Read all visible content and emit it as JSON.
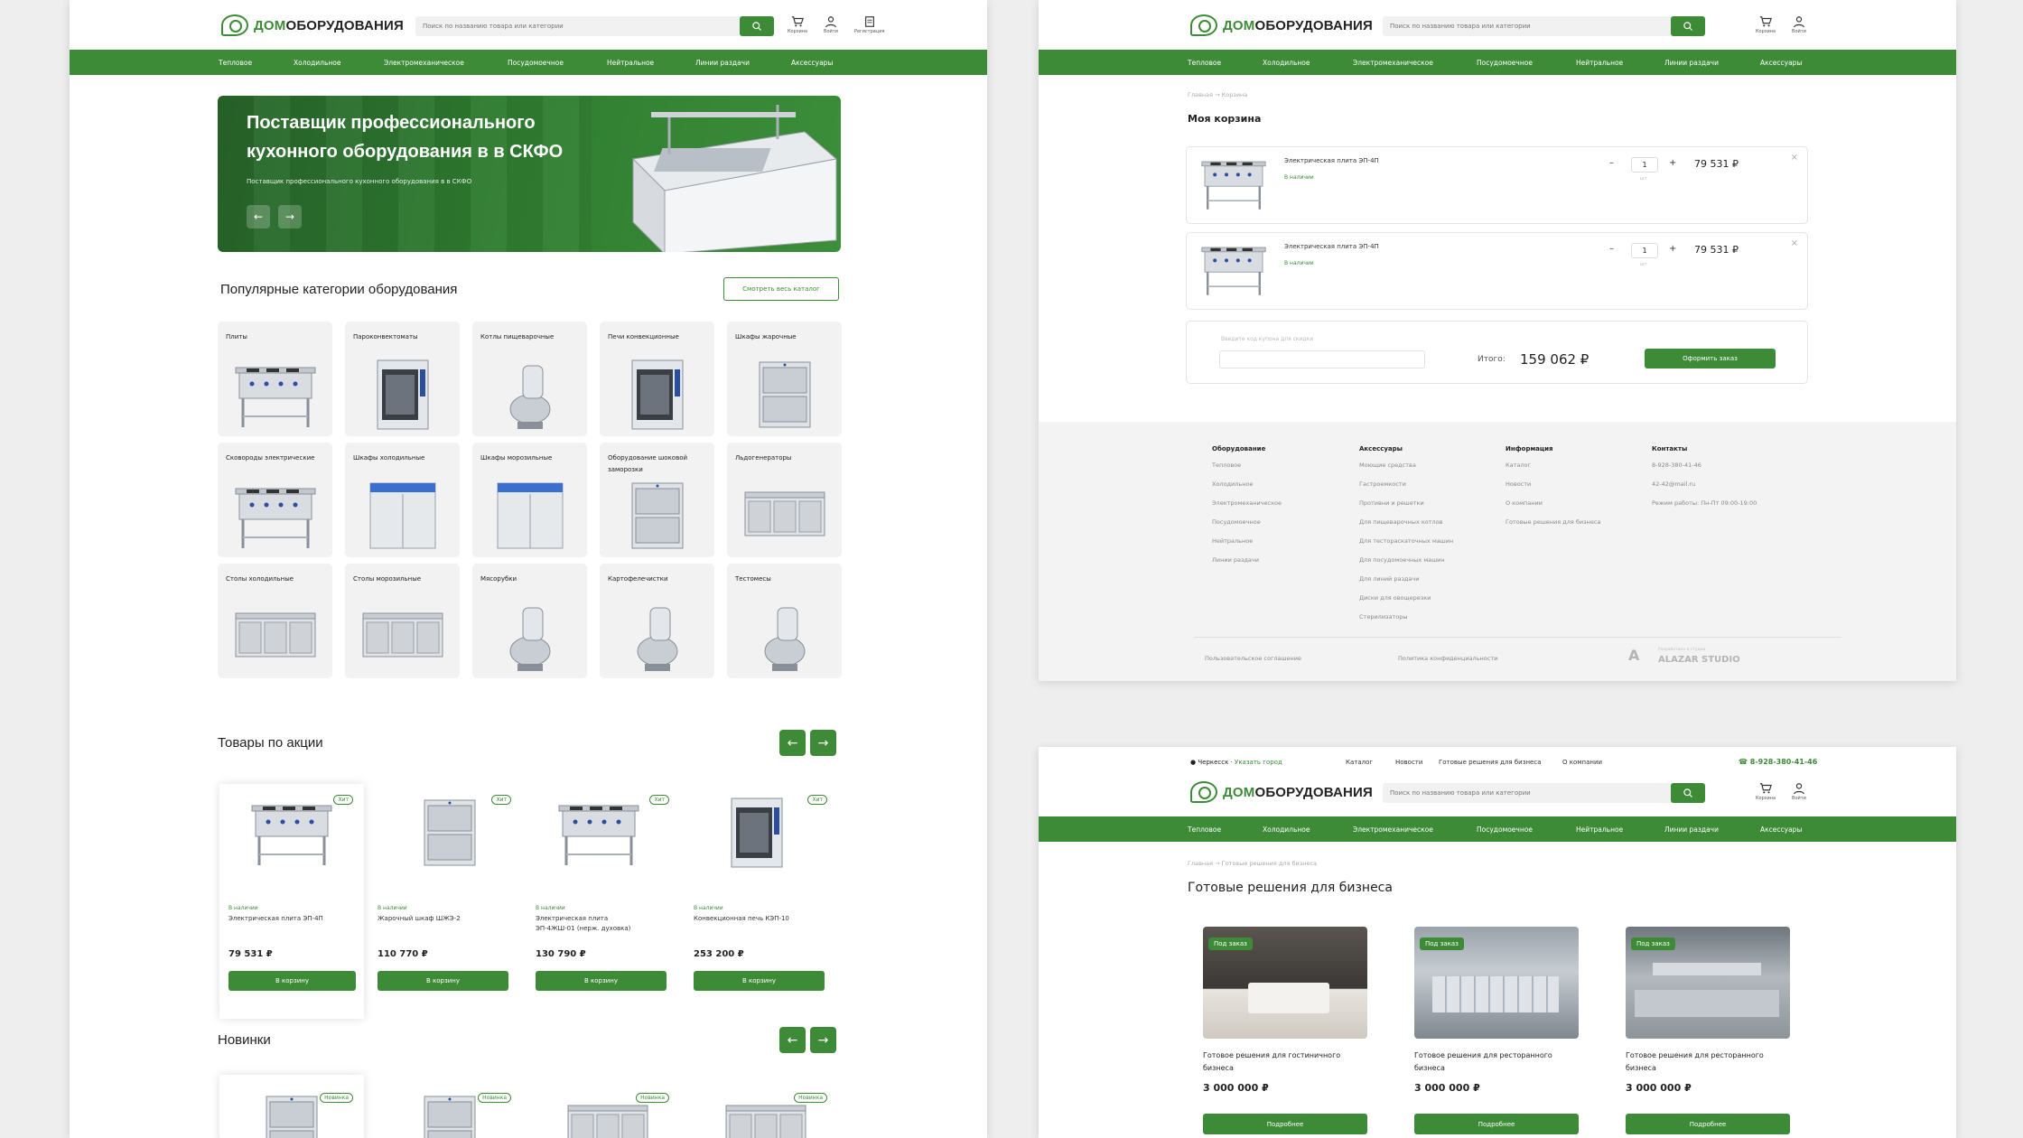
{
  "brand": {
    "logo_green": "ДОМ",
    "logo_black": "ОБОРУДОВАНИЯ"
  },
  "colors": {
    "accent": "#3d8b37",
    "bg_light": "#f2f2f2"
  },
  "search": {
    "placeholder": "Поиск по названию товара или категории"
  },
  "header_icons": {
    "cart": "Корзина",
    "login": "Войти",
    "register": "Регистрация"
  },
  "nav": [
    "Тепловое",
    "Холодильное",
    "Электромеханическое",
    "Посудомоечное",
    "Нейтральное",
    "Линии раздачи",
    "Аксессуары"
  ],
  "home": {
    "hero_title_1": "Поставщик профессионального",
    "hero_title_2": "кухонного оборудования в в СКФО",
    "hero_sub": "Поставщик профессионального кухонного оборудования в в СКФО",
    "popular_title": "Популярные категории оборудования",
    "catalog_btn": "Смотреть весь каталог",
    "categories": [
      "Плиты",
      "Пароконвектоматы",
      "Котлы пищеварочные",
      "Печи конвекционные",
      "Шкафы жарочные",
      "Сковороды электрические",
      "Шкафы холодильные",
      "Шкафы морозильные",
      "Оборудование шоковой заморозки",
      "Льдогенераторы",
      "Столы холодильные",
      "Столы морозильные",
      "Мясорубки",
      "Картофелечистки",
      "Тестомесы"
    ],
    "sale_title": "Товары по акции",
    "new_title": "Новинки",
    "products": [
      {
        "badge": "Хит",
        "stock": "В наличии",
        "name": "Электрическая плита ЭП-4П",
        "price": "79 531 ₽",
        "btn": "В корзину"
      },
      {
        "badge": "Хит",
        "stock": "В наличии",
        "name": "Жарочный шкаф ШЖЭ-2",
        "price": "110 770 ₽",
        "btn": "В корзину"
      },
      {
        "badge": "Хит",
        "stock": "В наличии",
        "name": "Электрическая плита ЭП-4ЖШ-01 (нерж. духовка)",
        "price": "130 790 ₽",
        "btn": "В корзину"
      },
      {
        "badge": "Хит",
        "stock": "В наличии",
        "name": "Конвекционная печь КЭП-10",
        "price": "253 200 ₽",
        "btn": "В корзину"
      }
    ],
    "new_badge": "Новинка"
  },
  "cart": {
    "crumb": "Главная → Корзина",
    "title": "Моя корзина",
    "items": [
      {
        "name": "Электрическая плита ЭП-4П",
        "stock": "В наличии",
        "qty": "1",
        "unit": "шт",
        "price": "79 531 ₽"
      },
      {
        "name": "Электрическая плита ЭП-4П",
        "stock": "В наличии",
        "qty": "1",
        "unit": "шт",
        "price": "79 531 ₽"
      }
    ],
    "coupon_placeholder": "Введите код купона для скидки",
    "total_label": "Итого:",
    "total_value": "159 062 ₽",
    "checkout": "Оформить заказ"
  },
  "footer": {
    "cols": [
      {
        "head": "Оборудование",
        "links": [
          "Тепловое",
          "Холодильное",
          "Электромеханическое",
          "Посудомоечное",
          "Нейтральное",
          "Линии раздачи"
        ]
      },
      {
        "head": "Аксессуары",
        "links": [
          "Моющие средства",
          "Гастроемкости",
          "Противни и решетки",
          "Для пищеварочных котлов",
          "Для тестораскаточных машин",
          "Для посудомоечных машин",
          "Для линий раздачи",
          "Диски для овощерезки",
          "Стерилизаторы"
        ]
      },
      {
        "head": "Информация",
        "links": [
          "Каталог",
          "Новости",
          "О компании",
          "Готовые решения для бизнеса"
        ]
      },
      {
        "head": "Контакты",
        "links": [
          "8-928-380-41-46",
          "42-42@mail.ru",
          "Режим работы: Пн-Пт 09:00-19:00"
        ]
      }
    ],
    "agreement": "Пользовательское соглашение",
    "privacy": "Политика конфиденциальности",
    "studio_small": "Разработано в студии",
    "studio": "ALAZAR STUDIO"
  },
  "solutions": {
    "city": "Черкесск",
    "choose_city": "Указать город",
    "topnav": [
      "Каталог",
      "Новости",
      "Готовые решения для бизнеса",
      "О компании"
    ],
    "phone": "8-928-380-41-46",
    "crumb": "Главная → Готовые решения для бизнеса",
    "title": "Готовые решения для бизнеса",
    "items": [
      {
        "badge": "Под заказ",
        "name": "Готовое решения для гостиничного бизнеса",
        "price": "3 000 000 ₽",
        "btn": "Подробнее"
      },
      {
        "badge": "Под заказ",
        "name": "Готовое решения для ресторанного бизнеса",
        "price": "3 000 000 ₽",
        "btn": "Подробнее"
      },
      {
        "badge": "Под заказ",
        "name": "Готовое решения для ресторанного бизнеса",
        "price": "3 000 000 ₽",
        "btn": "Подробнее"
      }
    ]
  }
}
